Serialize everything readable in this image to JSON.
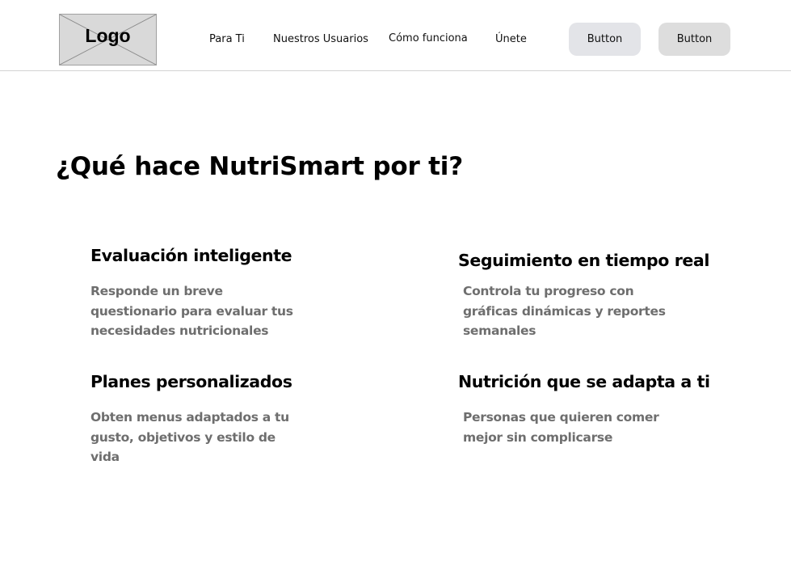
{
  "header": {
    "logo_text": "Logo",
    "nav": [
      {
        "label": "Para Ti"
      },
      {
        "label": "Nuestros Usuarios"
      },
      {
        "label": "Cómo funciona"
      },
      {
        "label": "Únete"
      }
    ],
    "buttons": [
      {
        "label": "Button"
      },
      {
        "label": "Button"
      }
    ]
  },
  "main": {
    "title": "¿Qué hace NutriSmart por ti?",
    "features": [
      {
        "title": "Evaluación inteligente",
        "description": "Responde un breve questionario  para evaluar tus necesidades nutricionales"
      },
      {
        "title": "Seguimiento en tiempo real",
        "description": "Controla tu progreso con gráficas dinámicas y reportes semanales"
      },
      {
        "title": "Planes personalizados",
        "description": "Obten menus adaptados a tu gusto, objetivos y estilo de vida"
      },
      {
        "title": "Nutrición que se adapta a ti",
        "description": "Personas que quieren comer mejor sin complicarse"
      }
    ]
  },
  "colors": {
    "header_border": "#d3d3d3",
    "logo_placeholder": "#d9d9d9",
    "button_1_bg": "#e3e4e8",
    "button_2_bg": "#dddddd",
    "description_text": "#6e6e6e"
  }
}
